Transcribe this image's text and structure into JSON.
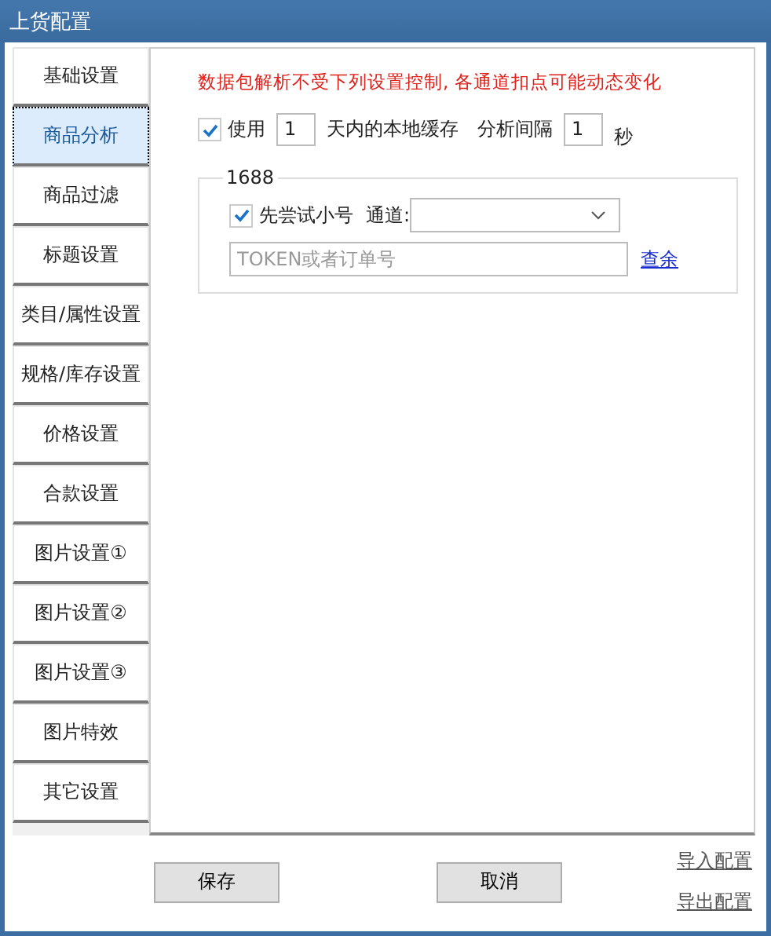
{
  "window": {
    "title": "上货配置"
  },
  "tabs": [
    {
      "label": "基础设置",
      "selected": false
    },
    {
      "label": "商品分析",
      "selected": true
    },
    {
      "label": "商品过滤",
      "selected": false
    },
    {
      "label": "标题设置",
      "selected": false
    },
    {
      "label": "类目/属性设置",
      "selected": false
    },
    {
      "label": "规格/库存设置",
      "selected": false
    },
    {
      "label": "价格设置",
      "selected": false
    },
    {
      "label": "合款设置",
      "selected": false
    },
    {
      "label": "图片设置①",
      "selected": false
    },
    {
      "label": "图片设置②",
      "selected": false
    },
    {
      "label": "图片设置③",
      "selected": false
    },
    {
      "label": "图片特效",
      "selected": false
    },
    {
      "label": "其它设置",
      "selected": false
    }
  ],
  "notice": "数据包解析不受下列设置控制, 各通道扣点可能动态变化",
  "cache": {
    "label": "使用",
    "checked": true,
    "days": "1",
    "days_suffix": "天内的本地缓存",
    "interval_label": "分析间隔",
    "interval": "1",
    "interval_unit": "秒"
  },
  "group": {
    "title": "1688",
    "trial": {
      "label": "先尝试小号",
      "checked": true
    },
    "channel_label": "通道:",
    "token": {
      "placeholder": "TOKEN或者订单号"
    },
    "query_link": "查余"
  },
  "buttons": [
    "保存",
    "取消"
  ],
  "links": [
    "导入配置",
    "导出配置"
  ]
}
